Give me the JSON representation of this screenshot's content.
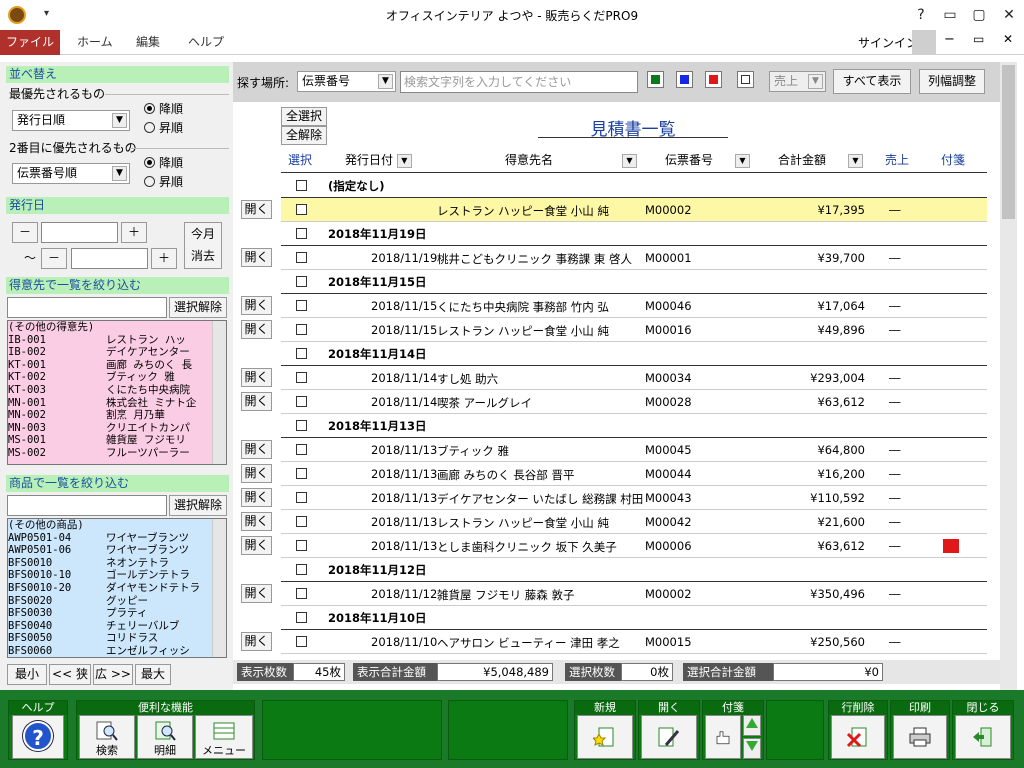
{
  "window": {
    "title": "オフィスインテリア よつや - 販売らくだPRO9",
    "signin": "サインイン"
  },
  "menu": {
    "file": "ファイル",
    "home": "ホーム",
    "edit": "編集",
    "help": "ヘルプ"
  },
  "sort": {
    "header": "並べ替え",
    "first_label": "最優先されるもの",
    "first_value": "発行日順",
    "second_label": "2番目に優先されるもの",
    "second_value": "伝票番号順",
    "desc": "降順",
    "asc": "昇順"
  },
  "issue_date": {
    "header": "発行日",
    "minus": "－",
    "plus": "＋",
    "tilde": "～",
    "this_month": "今月",
    "clear": "消去"
  },
  "customer_filter": {
    "header": "得意先で一覧を絞り込む",
    "clear_button": "選択解除",
    "items": [
      {
        "code": "(その他の得意先)",
        "name": ""
      },
      {
        "code": "IB-001",
        "name": "レストラン ハッ"
      },
      {
        "code": "IB-002",
        "name": "デイケアセンター"
      },
      {
        "code": "KT-001",
        "name": "画廊 みちのく 長"
      },
      {
        "code": "KT-002",
        "name": "ブティック 雅"
      },
      {
        "code": "KT-003",
        "name": "くにたち中央病院"
      },
      {
        "code": "MN-001",
        "name": "株式会社 ミナト企"
      },
      {
        "code": "MN-002",
        "name": "割烹 月乃華"
      },
      {
        "code": "MN-003",
        "name": "クリエイトカンパ"
      },
      {
        "code": "MS-001",
        "name": "雑貨屋 フジモリ"
      },
      {
        "code": "MS-002",
        "name": "フルーツパーラー"
      }
    ]
  },
  "product_filter": {
    "header": "商品で一覧を絞り込む",
    "clear_button": "選択解除",
    "items": [
      {
        "code": "(その他の商品)",
        "name": ""
      },
      {
        "code": "AWP0501-04",
        "name": "ワイヤーブランツ"
      },
      {
        "code": "AWP0501-06",
        "name": "ワイヤーブランツ"
      },
      {
        "code": "BFS0010",
        "name": "ネオンテトラ"
      },
      {
        "code": "BFS0010-10",
        "name": "ゴールデンテトラ"
      },
      {
        "code": "BFS0010-20",
        "name": "ダイヤモンドテトラ"
      },
      {
        "code": "BFS0020",
        "name": "グッピー"
      },
      {
        "code": "BFS0030",
        "name": "プラティ"
      },
      {
        "code": "BFS0040",
        "name": "チェリーバルブ"
      },
      {
        "code": "BFS0050",
        "name": "コリドラス"
      },
      {
        "code": "BFS0060",
        "name": "エンゼルフィッシ"
      }
    ]
  },
  "size_buttons": {
    "min": "最小",
    "narrow": "<< 狭",
    "wide": "広 >>",
    "max": "最大"
  },
  "search": {
    "label": "探す場所:",
    "field": "伝票番号",
    "placeholder": "検索文字列を入力してください",
    "sales_select": "売上",
    "show_all": "すべて表示",
    "col_adjust": "列幅調整",
    "colors": [
      "#0a7a1a",
      "#1428e6",
      "#e01818",
      "#ffffff"
    ]
  },
  "list": {
    "select_all": "全選択",
    "deselect_all": "全解除",
    "title": "見積書一覧",
    "headers": {
      "select": "選択",
      "date": "発行日付",
      "customer": "得意先名",
      "slip": "伝票番号",
      "total": "合計金額",
      "sales": "売上",
      "tag": "付箋"
    },
    "open_label": "開く",
    "rows": [
      {
        "kind": "group",
        "label": "(指定なし)"
      },
      {
        "kind": "item",
        "date": "",
        "customer": "レストラン ハッピー食堂 小山 純",
        "slip": "M00002",
        "total": "¥17,395",
        "sales": "―",
        "tag": "",
        "highlight": true
      },
      {
        "kind": "group",
        "label": "2018年11月19日"
      },
      {
        "kind": "item",
        "date": "2018/11/19",
        "customer": "桃井こどもクリニック 事務課 東 啓人",
        "slip": "M00001",
        "total": "¥39,700",
        "sales": "―",
        "tag": ""
      },
      {
        "kind": "group",
        "label": "2018年11月15日"
      },
      {
        "kind": "item",
        "date": "2018/11/15",
        "customer": "くにたち中央病院 事務部 竹内 弘",
        "slip": "M00046",
        "total": "¥17,064",
        "sales": "―",
        "tag": ""
      },
      {
        "kind": "item",
        "date": "2018/11/15",
        "customer": "レストラン ハッピー食堂 小山 純",
        "slip": "M00016",
        "total": "¥49,896",
        "sales": "―",
        "tag": ""
      },
      {
        "kind": "group",
        "label": "2018年11月14日"
      },
      {
        "kind": "item",
        "date": "2018/11/14",
        "customer": "すし処 助六",
        "slip": "M00034",
        "total": "¥293,004",
        "sales": "―",
        "tag": ""
      },
      {
        "kind": "item",
        "date": "2018/11/14",
        "customer": "喫茶 アールグレイ",
        "slip": "M00028",
        "total": "¥63,612",
        "sales": "―",
        "tag": ""
      },
      {
        "kind": "group",
        "label": "2018年11月13日"
      },
      {
        "kind": "item",
        "date": "2018/11/13",
        "customer": "ブティック 雅",
        "slip": "M00045",
        "total": "¥64,800",
        "sales": "―",
        "tag": ""
      },
      {
        "kind": "item",
        "date": "2018/11/13",
        "customer": "画廊 みちのく 長谷部 晋平",
        "slip": "M00044",
        "total": "¥16,200",
        "sales": "―",
        "tag": ""
      },
      {
        "kind": "item",
        "date": "2018/11/13",
        "customer": "デイケアセンター いたばし 総務課 村田",
        "slip": "M00043",
        "total": "¥110,592",
        "sales": "―",
        "tag": ""
      },
      {
        "kind": "item",
        "date": "2018/11/13",
        "customer": "レストラン ハッピー食堂 小山 純",
        "slip": "M00042",
        "total": "¥21,600",
        "sales": "―",
        "tag": ""
      },
      {
        "kind": "item",
        "date": "2018/11/13",
        "customer": "としま歯科クリニック 坂下 久美子",
        "slip": "M00006",
        "total": "¥63,612",
        "sales": "―",
        "tag": "red"
      },
      {
        "kind": "group",
        "label": "2018年11月12日"
      },
      {
        "kind": "item",
        "date": "2018/11/12",
        "customer": "雑貨屋 フジモリ 藤森 敦子",
        "slip": "M00002",
        "total": "¥350,496",
        "sales": "―",
        "tag": ""
      },
      {
        "kind": "group",
        "label": "2018年11月10日"
      },
      {
        "kind": "item",
        "date": "2018/11/10",
        "customer": "ヘアサロン ビューティー 津田 孝之",
        "slip": "M00015",
        "total": "¥250,560",
        "sales": "―",
        "tag": ""
      }
    ]
  },
  "status": {
    "count_label": "表示枚数",
    "count_value": "45枚",
    "total_label": "表示合計金額",
    "total_value": "¥5,048,489",
    "sel_count_label": "選択枚数",
    "sel_count_value": "0枚",
    "sel_total_label": "選択合計金額",
    "sel_total_value": "¥0"
  },
  "toolbar": {
    "help": "ヘルプ",
    "tools": "便利な機能",
    "search": "検索",
    "detail": "明細",
    "menu": "メニュー",
    "new": "新規",
    "open": "開く",
    "tag": "付箋",
    "delete_row": "行削除",
    "print": "印刷",
    "close": "閉じる"
  }
}
